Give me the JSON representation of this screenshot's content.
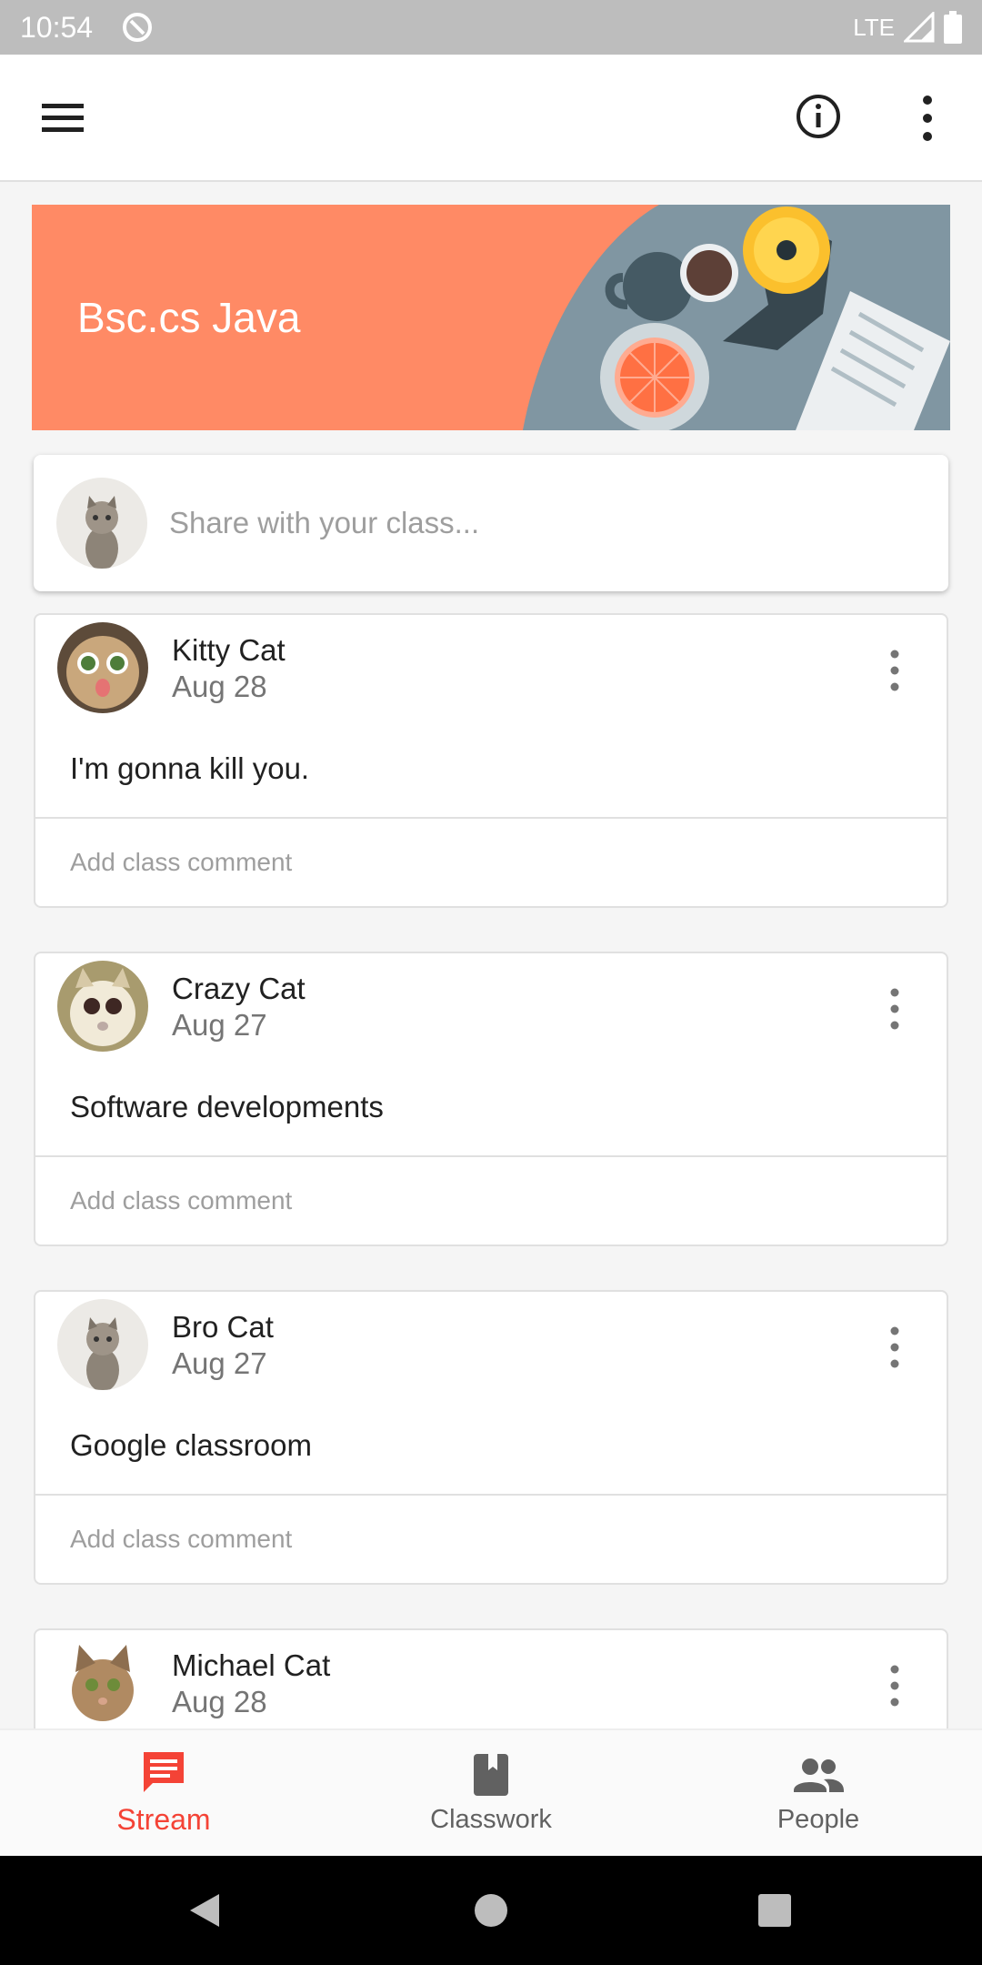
{
  "status_bar": {
    "time": "10:54",
    "network": "LTE"
  },
  "app_bar": {
    "menu_icon": "hamburger-menu-icon",
    "info_icon": "info-icon",
    "more_icon": "more-vert-icon"
  },
  "banner": {
    "title": "Bsc.cs Java",
    "color": "#ff8a65"
  },
  "share": {
    "placeholder": "Share with your class..."
  },
  "posts": [
    {
      "author": "Kitty Cat",
      "date": "Aug 28",
      "text": "I'm gonna kill you.",
      "comment_placeholder": "Add class comment"
    },
    {
      "author": "Crazy Cat",
      "date": "Aug 27",
      "text": "Software developments",
      "comment_placeholder": "Add class comment"
    },
    {
      "author": "Bro Cat",
      "date": "Aug 27",
      "text": "Google classroom",
      "comment_placeholder": "Add class comment"
    },
    {
      "author": "Michael Cat",
      "date": "Aug 28"
    }
  ],
  "bottom_nav": [
    {
      "label": "Stream",
      "icon": "stream-icon",
      "active": true
    },
    {
      "label": "Classwork",
      "icon": "classwork-icon",
      "active": false
    },
    {
      "label": "People",
      "icon": "people-icon",
      "active": false
    }
  ],
  "colors": {
    "accent": "#f44336"
  }
}
